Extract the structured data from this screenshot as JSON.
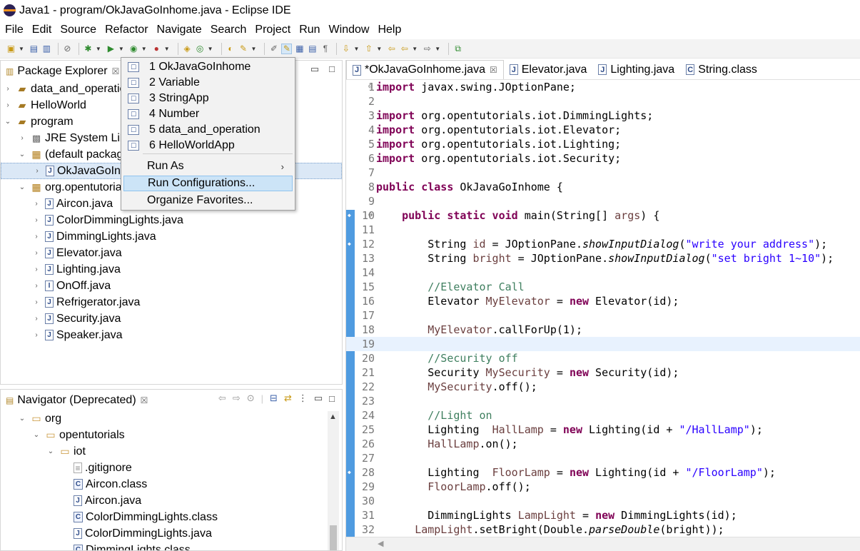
{
  "window": {
    "title": "Java1 - program/OkJavaGoInhome.java - Eclipse IDE"
  },
  "menubar": [
    "File",
    "Edit",
    "Source",
    "Refactor",
    "Navigate",
    "Search",
    "Project",
    "Run",
    "Window",
    "Help"
  ],
  "package_explorer": {
    "title": "Package Explorer",
    "items": [
      {
        "label": "data_and_operatic",
        "icon": "project-icon",
        "twisty": "collapsed"
      },
      {
        "label": "HelloWorld",
        "icon": "project-icon",
        "twisty": "collapsed"
      },
      {
        "label": "program",
        "icon": "project-icon",
        "twisty": "expanded"
      },
      {
        "label": "JRE System Libr",
        "icon": "library-icon",
        "twisty": "collapsed"
      },
      {
        "label": "(default packag",
        "icon": "package-icon",
        "twisty": "expanded"
      },
      {
        "label": "OkJavaGoInl",
        "icon": "java-file-icon",
        "twisty": "collapsed",
        "selected": true
      },
      {
        "label": "org.opentutoria",
        "icon": "package-icon",
        "twisty": "expanded"
      },
      {
        "label": "Aircon.java",
        "icon": "java-file-icon",
        "twisty": "collapsed"
      },
      {
        "label": "ColorDimmingLights.java",
        "icon": "java-file-icon",
        "twisty": "collapsed"
      },
      {
        "label": "DimmingLights.java",
        "icon": "java-file-icon",
        "twisty": "collapsed"
      },
      {
        "label": "Elevator.java",
        "icon": "java-file-icon",
        "twisty": "collapsed"
      },
      {
        "label": "Lighting.java",
        "icon": "java-file-icon",
        "twisty": "collapsed"
      },
      {
        "label": "OnOff.java",
        "icon": "java-interface-icon",
        "twisty": "collapsed"
      },
      {
        "label": "Refrigerator.java",
        "icon": "java-file-icon",
        "twisty": "collapsed"
      },
      {
        "label": "Security.java",
        "icon": "java-file-icon",
        "twisty": "collapsed"
      },
      {
        "label": "Speaker.java",
        "icon": "java-file-icon",
        "twisty": "collapsed"
      }
    ]
  },
  "navigator": {
    "title": "Navigator (Deprecated)",
    "items": [
      {
        "label": "org",
        "icon": "folder-icon",
        "twisty": "expanded"
      },
      {
        "label": "opentutorials",
        "icon": "folder-icon",
        "twisty": "expanded"
      },
      {
        "label": "iot",
        "icon": "folder-icon",
        "twisty": "expanded"
      },
      {
        "label": ".gitignore",
        "icon": "file-icon",
        "twisty": ""
      },
      {
        "label": "Aircon.class",
        "icon": "class-file-icon",
        "twisty": ""
      },
      {
        "label": "Aircon.java",
        "icon": "java-file-icon",
        "twisty": ""
      },
      {
        "label": "ColorDimmingLights.class",
        "icon": "class-file-icon",
        "twisty": ""
      },
      {
        "label": "ColorDimmingLights.java",
        "icon": "java-file-icon",
        "twisty": ""
      },
      {
        "label": "DimmingLights.class",
        "icon": "class-file-icon",
        "twisty": ""
      }
    ]
  },
  "run_menu": {
    "history": [
      "1 OkJavaGoInhome",
      "2 Variable",
      "3 StringApp",
      "4 Number",
      "5 data_and_operation",
      "6 HelloWorldApp"
    ],
    "run_as": "Run As",
    "run_configurations": "Run Configurations...",
    "organize_favorites": "Organize Favorites..."
  },
  "editor": {
    "tabs": [
      {
        "label": "*OkJavaGoInhome.java",
        "active": true
      },
      {
        "label": "Elevator.java",
        "active": false
      },
      {
        "label": "Lighting.java",
        "active": false
      },
      {
        "label": "String.class",
        "active": false
      }
    ],
    "current_line": 19,
    "lines": [
      {
        "n": "1",
        "tokens": [
          [
            "kw",
            "import"
          ],
          [
            "",
            " javax.swing.JOptionPane;"
          ]
        ]
      },
      {
        "n": "2",
        "tokens": []
      },
      {
        "n": "3",
        "tokens": [
          [
            "kw",
            "import"
          ],
          [
            "",
            " org.opentutorials.iot.DimmingLights;"
          ]
        ]
      },
      {
        "n": "4",
        "tokens": [
          [
            "kw",
            "import"
          ],
          [
            "",
            " org.opentutorials.iot.Elevator;"
          ]
        ]
      },
      {
        "n": "5",
        "tokens": [
          [
            "kw",
            "import"
          ],
          [
            "",
            " org.opentutorials.iot.Lighting;"
          ]
        ]
      },
      {
        "n": "6",
        "tokens": [
          [
            "kw",
            "import"
          ],
          [
            "",
            " org.opentutorials.iot.Security;"
          ]
        ]
      },
      {
        "n": "7",
        "tokens": []
      },
      {
        "n": "8",
        "tokens": [
          [
            "kw",
            "public class"
          ],
          [
            "",
            " OkJavaGoInhome {"
          ]
        ]
      },
      {
        "n": "9",
        "tokens": []
      },
      {
        "n": "10",
        "tokens": [
          [
            "",
            "    "
          ],
          [
            "kw",
            "public static void"
          ],
          [
            "",
            " main(String[] "
          ],
          [
            "fld",
            "args"
          ],
          [
            "",
            ") {"
          ]
        ]
      },
      {
        "n": "11",
        "tokens": []
      },
      {
        "n": "12",
        "tokens": [
          [
            "",
            "        String "
          ],
          [
            "fld",
            "id"
          ],
          [
            "",
            " = JOptionPane."
          ],
          [
            "it",
            "showInputDialog"
          ],
          [
            "",
            "("
          ],
          [
            "str",
            "\"write your address\""
          ],
          [
            "",
            ");"
          ]
        ]
      },
      {
        "n": "13",
        "tokens": [
          [
            "",
            "        String "
          ],
          [
            "fld",
            "bright"
          ],
          [
            "",
            " = JOptionPane."
          ],
          [
            "it",
            "showInputDialog"
          ],
          [
            "",
            "("
          ],
          [
            "str",
            "\"set bright 1~10\""
          ],
          [
            "",
            ");"
          ]
        ]
      },
      {
        "n": "14",
        "tokens": []
      },
      {
        "n": "15",
        "tokens": [
          [
            "",
            "        "
          ],
          [
            "cm",
            "//Elevator Call"
          ]
        ]
      },
      {
        "n": "16",
        "tokens": [
          [
            "",
            "        Elevator "
          ],
          [
            "fld",
            "MyElevator"
          ],
          [
            "",
            " = "
          ],
          [
            "kw",
            "new"
          ],
          [
            "",
            " Elevator(id);"
          ]
        ]
      },
      {
        "n": "17",
        "tokens": []
      },
      {
        "n": "18",
        "tokens": [
          [
            "",
            "        "
          ],
          [
            "fld",
            "MyElevator"
          ],
          [
            "",
            ".callForUp(1);"
          ]
        ]
      },
      {
        "n": "19",
        "tokens": []
      },
      {
        "n": "20",
        "tokens": [
          [
            "",
            "        "
          ],
          [
            "cm",
            "//Security off"
          ]
        ]
      },
      {
        "n": "21",
        "tokens": [
          [
            "",
            "        Security "
          ],
          [
            "fld",
            "MySecurity"
          ],
          [
            "",
            " = "
          ],
          [
            "kw",
            "new"
          ],
          [
            "",
            " Security(id);"
          ]
        ]
      },
      {
        "n": "22",
        "tokens": [
          [
            "",
            "        "
          ],
          [
            "fld",
            "MySecurity"
          ],
          [
            "",
            ".off();"
          ]
        ]
      },
      {
        "n": "23",
        "tokens": []
      },
      {
        "n": "24",
        "tokens": [
          [
            "",
            "        "
          ],
          [
            "cm",
            "//Light on"
          ]
        ]
      },
      {
        "n": "25",
        "tokens": [
          [
            "",
            "        Lighting  "
          ],
          [
            "fld",
            "HallLamp"
          ],
          [
            "",
            " = "
          ],
          [
            "kw",
            "new"
          ],
          [
            "",
            " Lighting(id + "
          ],
          [
            "str",
            "\"/HallLamp\""
          ],
          [
            "",
            ");"
          ]
        ]
      },
      {
        "n": "26",
        "tokens": [
          [
            "",
            "        "
          ],
          [
            "fld",
            "HallLamp"
          ],
          [
            "",
            ".on();"
          ]
        ]
      },
      {
        "n": "27",
        "tokens": []
      },
      {
        "n": "28",
        "tokens": [
          [
            "",
            "        Lighting  "
          ],
          [
            "fld",
            "FloorLamp"
          ],
          [
            "",
            " = "
          ],
          [
            "kw",
            "new"
          ],
          [
            "",
            " Lighting(id + "
          ],
          [
            "str",
            "\"/FloorLamp\""
          ],
          [
            "",
            ");"
          ]
        ]
      },
      {
        "n": "29",
        "tokens": [
          [
            "",
            "        "
          ],
          [
            "fld",
            "FloorLamp"
          ],
          [
            "",
            ".off();"
          ]
        ]
      },
      {
        "n": "30",
        "tokens": []
      },
      {
        "n": "31",
        "tokens": [
          [
            "",
            "        DimmingLights "
          ],
          [
            "fld",
            "LampLight"
          ],
          [
            "",
            " = "
          ],
          [
            "kw",
            "new"
          ],
          [
            "",
            " DimmingLights(id);"
          ]
        ]
      },
      {
        "n": "32",
        "tokens": [
          [
            "",
            "      "
          ],
          [
            "fld",
            "LampLight"
          ],
          [
            "",
            ".setBright(Double."
          ],
          [
            "it",
            "parseDouble"
          ],
          [
            "",
            "(bright));"
          ]
        ]
      }
    ]
  }
}
